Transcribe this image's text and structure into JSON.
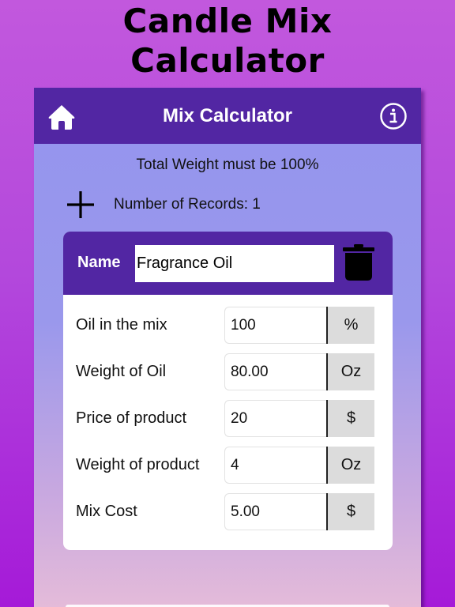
{
  "promo": {
    "title_line1": "Candle Mix",
    "title_line2": "Calculator"
  },
  "navbar": {
    "title": "Mix Calculator",
    "left_icon": "home-icon",
    "right_icon": "info-icon"
  },
  "summary": {
    "note": "Total Weight must be 100%",
    "add_icon": "plus-icon",
    "records_label": "Number of Records: 1"
  },
  "record": {
    "name_label": "Name",
    "name_value": "Fragrance Oil",
    "delete_icon": "trash-icon",
    "fields": [
      {
        "label": "Oil in the mix",
        "value": "100",
        "unit": "%"
      },
      {
        "label": "Weight of Oil",
        "value": "80.00",
        "unit": "Oz"
      },
      {
        "label": "Price of product",
        "value": "20",
        "unit": "$"
      },
      {
        "label": "Weight of product",
        "value": "4",
        "unit": "Oz"
      },
      {
        "label": "Mix Cost",
        "value": "5.00",
        "unit": "$"
      }
    ]
  },
  "colors": {
    "header": "#5226a3",
    "page_background": "#b348dc",
    "content_background": "#9494ee",
    "unit_background": "#dcdcdc"
  }
}
